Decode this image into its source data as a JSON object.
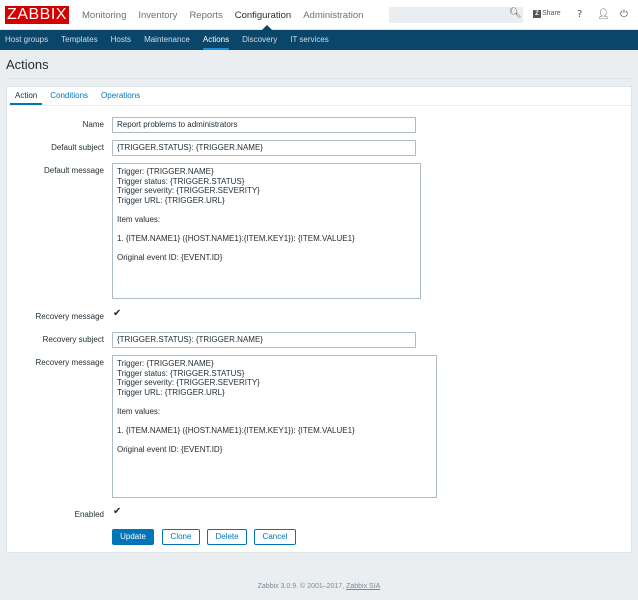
{
  "header": {
    "logo": "ZABBIX",
    "menu": [
      "Monitoring",
      "Inventory",
      "Reports",
      "Configuration",
      "Administration"
    ],
    "share": "Share",
    "help": "?"
  },
  "subnav": [
    "Host groups",
    "Templates",
    "Hosts",
    "Maintenance",
    "Actions",
    "Discovery",
    "IT services"
  ],
  "page_title": "Actions",
  "tabs": [
    "Action",
    "Conditions",
    "Operations"
  ],
  "form": {
    "name_label": "Name",
    "name_value": "Report problems to administrators",
    "default_subject_label": "Default subject",
    "default_subject_value": "{TRIGGER.STATUS}: {TRIGGER.NAME}",
    "default_message_label": "Default message",
    "default_message_value": "Trigger: {TRIGGER.NAME}\nTrigger status: {TRIGGER.STATUS}\nTrigger severity: {TRIGGER.SEVERITY}\nTrigger URL: {TRIGGER.URL}\n\nItem values:\n\n1. {ITEM.NAME1} ({HOST.NAME1}:{ITEM.KEY1}): {ITEM.VALUE1}\n\nOriginal event ID: {EVENT.ID}",
    "recovery_message_check_label": "Recovery message",
    "recovery_subject_label": "Recovery subject",
    "recovery_subject_value": "{TRIGGER.STATUS}: {TRIGGER.NAME}",
    "recovery_message_label": "Recovery message",
    "recovery_message_value": "Trigger: {TRIGGER.NAME}\nTrigger status: {TRIGGER.STATUS}\nTrigger severity: {TRIGGER.SEVERITY}\nTrigger URL: {TRIGGER.URL}\n\nItem values:\n\n1. {ITEM.NAME1} ({HOST.NAME1}:{ITEM.KEY1}): {ITEM.VALUE1}\n\nOriginal event ID: {EVENT.ID}",
    "enabled_label": "Enabled"
  },
  "buttons": {
    "update": "Update",
    "clone": "Clone",
    "delete": "Delete",
    "cancel": "Cancel"
  },
  "footer": {
    "text": "Zabbix 3.0.9. © 2001–2017, ",
    "link": "Zabbix SIA"
  }
}
